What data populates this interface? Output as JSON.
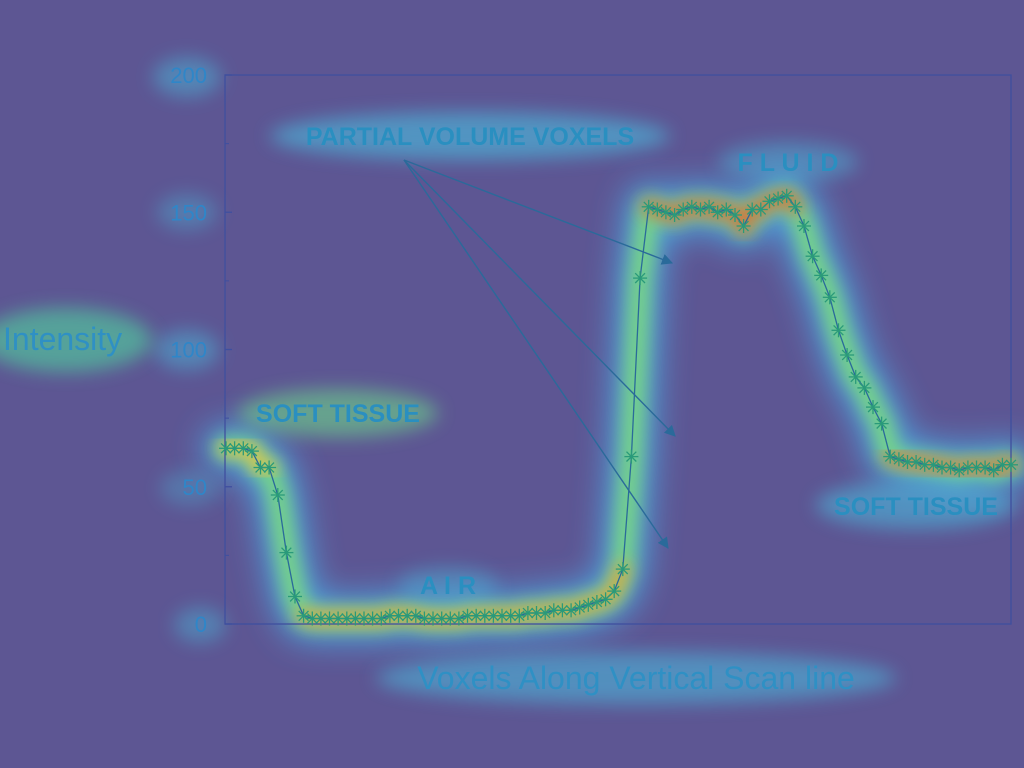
{
  "chart_data": {
    "type": "line",
    "title": "",
    "xlabel": "Voxels Along Vertical Scan line",
    "ylabel": "Intensity",
    "ylim": [
      0,
      200
    ],
    "yticks": [
      "0",
      "50",
      "100",
      "150",
      "200"
    ],
    "grid": false,
    "series": [
      {
        "name": "",
        "values": [
          64,
          64,
          64,
          63,
          57,
          57,
          47,
          26,
          10,
          3,
          2,
          2,
          2,
          2,
          2,
          2,
          2,
          2,
          2,
          3,
          3,
          3,
          3,
          2,
          2,
          2,
          2,
          2,
          3,
          3,
          3,
          3,
          3,
          3,
          3,
          4,
          4,
          4,
          5,
          5,
          5,
          6,
          7,
          8,
          9,
          12,
          20,
          61,
          126,
          152,
          151,
          150,
          149,
          151,
          152,
          151,
          152,
          150,
          151,
          149,
          145,
          151,
          151,
          154,
          155,
          156,
          152,
          145,
          134,
          127,
          119,
          107,
          98,
          90,
          86,
          79,
          73,
          61,
          60,
          59,
          59,
          58,
          58,
          57,
          57,
          56,
          57,
          57,
          57,
          56,
          58,
          58
        ]
      }
    ],
    "annotations": [
      {
        "text": "PARTIAL VOLUME VOXELS"
      },
      {
        "text": "F L U I D"
      },
      {
        "text": "SOFT TISSUE"
      },
      {
        "text": "A I R"
      },
      {
        "text": "SOFT TISSUE"
      }
    ],
    "colors": {
      "line": "#2a6a9a",
      "marker": "#2a9a7a",
      "text": "#2f90c4",
      "axis": "#3f4f9f",
      "background": "#5d5693"
    }
  }
}
